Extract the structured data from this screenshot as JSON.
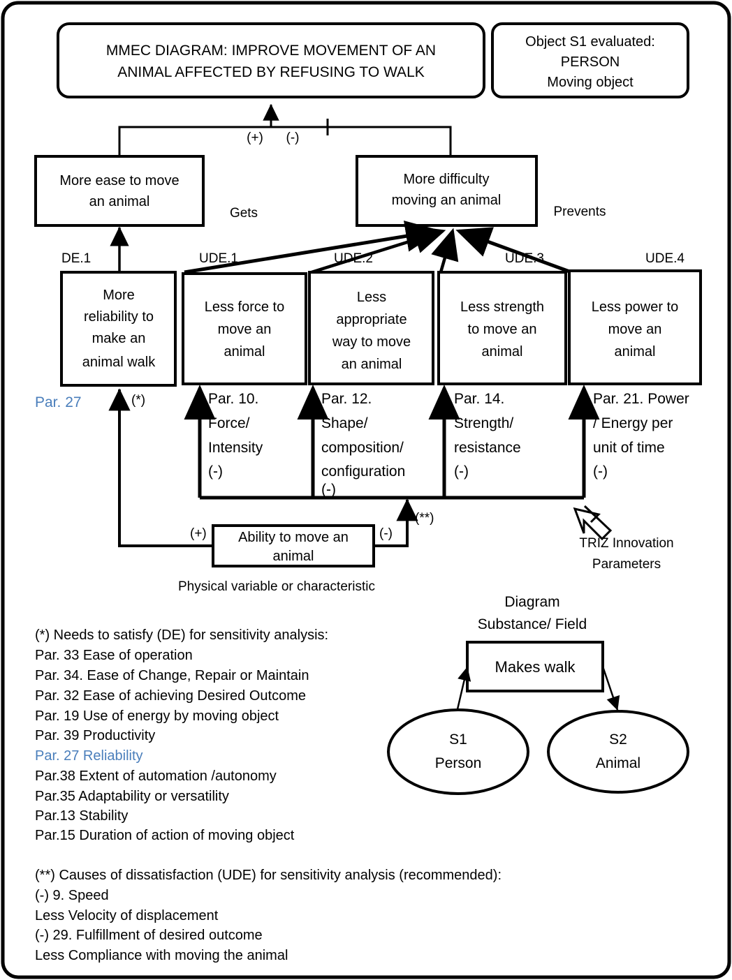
{
  "page": {
    "border_color": "#000000",
    "accent_blue": "#4a7ebb"
  },
  "title_box": {
    "line1": "MMEC DIAGRAM: IMPROVE MOVEMENT OF AN",
    "line2": "ANIMAL AFFECTED BY REFUSING TO WALK"
  },
  "object_box": {
    "line1": "Object S1 evaluated:",
    "line2": "PERSON",
    "line3": "Moving object"
  },
  "branch_labels": {
    "plus": "(+)",
    "minus": "(-)"
  },
  "effect_boxes": {
    "left": {
      "line1": "More ease to move",
      "line2": "an animal"
    },
    "right": {
      "line1": "More difficulty",
      "line2": "moving an animal"
    },
    "gets_label": "Gets",
    "prevents_label": "Prevents"
  },
  "cause_tags": [
    "DE.1",
    "UDE.1",
    "UDE.2",
    "UDE.3",
    "UDE.4"
  ],
  "cause_boxes": [
    {
      "tag": "DE.1",
      "lines": [
        "More",
        "reliability to",
        "make an",
        "animal walk"
      ]
    },
    {
      "tag": "UDE.1",
      "lines": [
        "Less force to",
        "move an",
        "animal"
      ]
    },
    {
      "tag": "UDE.2",
      "lines": [
        "Less",
        "appropriate",
        "way to move",
        "an animal"
      ]
    },
    {
      "tag": "UDE.3",
      "lines": [
        "Less strength",
        "to move an",
        "animal"
      ]
    },
    {
      "tag": "UDE.4",
      "lines": [
        "Less power to",
        "move an",
        "animal"
      ]
    }
  ],
  "parameters": {
    "de1_label": "Par. 27",
    "de1_star": "(*)",
    "items": [
      {
        "lines": [
          "Par. 10.",
          "Force/",
          "Intensity",
          "(-)"
        ]
      },
      {
        "lines": [
          "Par. 12.",
          "Shape/",
          "composition/",
          "configuration",
          "(-)"
        ]
      },
      {
        "lines": [
          "Par. 14.",
          "Strength/",
          "resistance",
          "(-)"
        ]
      },
      {
        "lines": [
          "Par. 21. Power",
          "/ Energy per",
          "unit of time",
          "(-)"
        ]
      }
    ]
  },
  "ability_box": {
    "line1": "Ability to move an",
    "line2": "animal",
    "plus": "(+)",
    "minus": "(-)",
    "double_star": "(**)",
    "caption": "Physical variable or characteristic"
  },
  "triz": {
    "line1": "TRIZ Innovation",
    "line2": "Parameters",
    "icon": "up-left-block-arrow-icon"
  },
  "notes_de": {
    "heading": "(*) Needs to satisfy (DE) for sensitivity analysis:",
    "items": [
      {
        "text": "Par. 33 Ease of operation",
        "highlight": false
      },
      {
        "text": "Par. 34. Ease of Change, Repair or Maintain",
        "highlight": false
      },
      {
        "text": "Par. 32 Ease of achieving Desired Outcome",
        "highlight": false
      },
      {
        "text": "Par. 19 Use of energy by moving object",
        "highlight": false
      },
      {
        "text": "Par. 39 Productivity",
        "highlight": false
      },
      {
        "text": "Par. 27  Reliability",
        "highlight": true
      },
      {
        "text": "Par.38 Extent of automation /autonomy",
        "highlight": false
      },
      {
        "text": "Par.35  Adaptability or versatility",
        "highlight": false
      },
      {
        "text": "Par.13 Stability",
        "highlight": false
      },
      {
        "text": "Par.15 Duration of action of moving object",
        "highlight": false
      }
    ]
  },
  "notes_ude": {
    "heading": "(**) Causes of dissatisfaction (UDE) for sensitivity analysis (recommended):",
    "items": [
      {
        "text": "(-) 9.  Speed"
      },
      {
        "text": "Less Velocity of displacement"
      },
      {
        "text": "(-) 29. Fulfillment of desired outcome"
      },
      {
        "text": "Less Compliance with moving the animal"
      }
    ]
  },
  "sufield": {
    "title_line1": "Diagram",
    "title_line2": "Substance/ Field",
    "field_box": "Makes walk",
    "s1_line1": "S1",
    "s1_line2": "Person",
    "s2_line1": "S2",
    "s2_line2": "Animal"
  }
}
